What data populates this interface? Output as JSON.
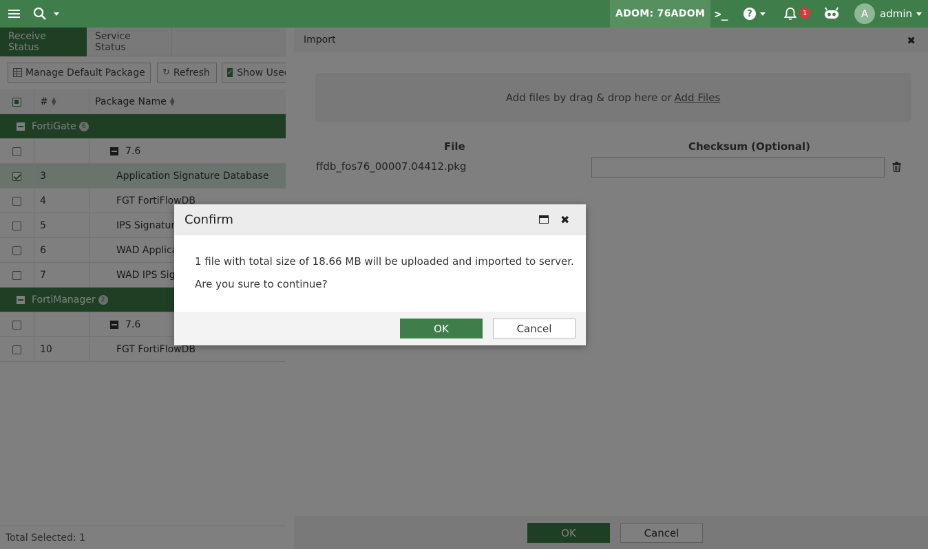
{
  "topbar": {
    "adom_label": "ADOM: 76ADOM",
    "cli_label": ">_",
    "help_label": "?",
    "notification_count": "1",
    "avatar_initial": "A",
    "user_name": "admin"
  },
  "tabs": [
    {
      "label": "Receive Status",
      "active": true
    },
    {
      "label": "Service Status",
      "active": false
    }
  ],
  "toolbar": {
    "manage_label": "Manage Default Package",
    "refresh_label": "Refresh",
    "show_used_label": "Show Used"
  },
  "grid": {
    "columns": [
      "#",
      "Package Name"
    ],
    "groups": [
      {
        "name": "FortiGate",
        "count": "6",
        "subgroup": "7.6",
        "rows": [
          {
            "num": "3",
            "name": "Application Signature Database",
            "checked": true
          },
          {
            "num": "4",
            "name": "FGT FortiFlowDB",
            "checked": false
          },
          {
            "num": "5",
            "name": "IPS Signature",
            "checked": false
          },
          {
            "num": "6",
            "name": "WAD Applica",
            "checked": false
          },
          {
            "num": "7",
            "name": "WAD IPS Sig",
            "checked": false
          }
        ]
      },
      {
        "name": "FortiManager",
        "count": "2",
        "subgroup": "7.6",
        "rows": [
          {
            "num": "10",
            "name": "FGT FortiFlowDB",
            "checked": false
          }
        ]
      }
    ]
  },
  "footer": {
    "total_selected": "Total Selected: 1"
  },
  "import_panel": {
    "title": "Import",
    "drop_text": "Add files by drag & drop here or",
    "add_files_label": "Add Files",
    "file_col": "File",
    "checksum_col": "Checksum (Optional)",
    "file_name": "ffdb_fos76_00007.04412.pkg",
    "checksum_value": "",
    "ok_label": "OK",
    "cancel_label": "Cancel"
  },
  "confirm": {
    "title": "Confirm",
    "message": "1 file with total size of 18.66 MB will be uploaded and imported to server.",
    "question": "Are you sure to continue?",
    "ok_label": "OK",
    "cancel_label": "Cancel"
  },
  "colors": {
    "brand_green": "#3f7e4a",
    "notification_red": "#d33a3a"
  }
}
